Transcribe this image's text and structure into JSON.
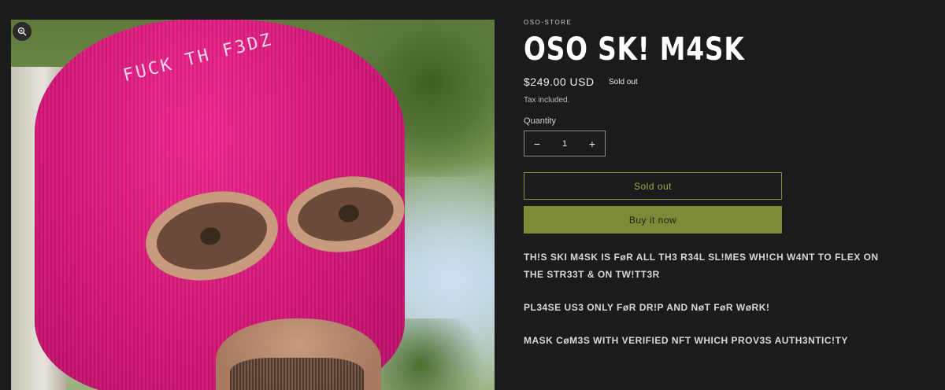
{
  "media": {
    "image_alt": "Pink knit ski mask",
    "mask_text": "FUCK TH F3DZ",
    "zoom_icon": "magnifier-icon"
  },
  "product": {
    "vendor": "OSO-STORE",
    "title": "OSO SK! M4SK",
    "price": "$249.00 USD",
    "badge": "Sold out",
    "tax_note": "Tax included.",
    "quantity_label": "Quantity",
    "quantity_value": "1",
    "decrease_symbol": "−",
    "increase_symbol": "+",
    "sold_out_button": "Sold out",
    "buy_now_button": "Buy it now",
    "description": [
      "TH!S SKI M4SK IS FøR ALL TH3 R34L SL!MES WH!CH W4NT TO FLEX ON THE STR33T & ON TW!TT3R",
      "PL34SE US3 ONLY FøR DR!P AND NøT FøR WøRK!",
      "MASK CøM3S WITH VERIFIED NFT WHICH PROV3S AUTH3NTIC!TY"
    ]
  },
  "colors": {
    "background": "#1b1b1d",
    "accent": "#7d8b37",
    "mask": "#e0187f"
  }
}
